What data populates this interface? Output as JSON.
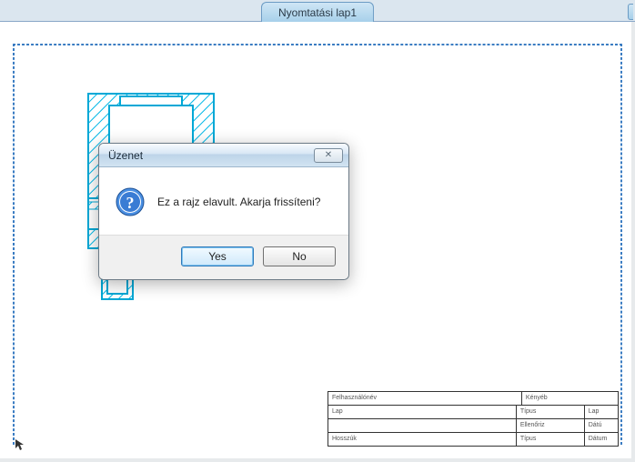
{
  "tab": {
    "label": "Nyomtatási lap1"
  },
  "dialog": {
    "title": "Üzenet",
    "message": "Ez a rajz elavult. Akarja frissíteni?",
    "yes": "Yes",
    "no": "No",
    "close_icon": "✕"
  },
  "titleblock": {
    "r1c1": "Felhasználónév",
    "r1c2": "Kényéb",
    "r2c1": "Lap",
    "r2c2": "Típus",
    "r2c3": "Lap",
    "r3c1": "",
    "r3c2": "Ellenőriz",
    "r3c3": "Dátú",
    "r4c1": "Hosszúk",
    "r4c2": "Típus",
    "r4c3": "Dátum"
  }
}
